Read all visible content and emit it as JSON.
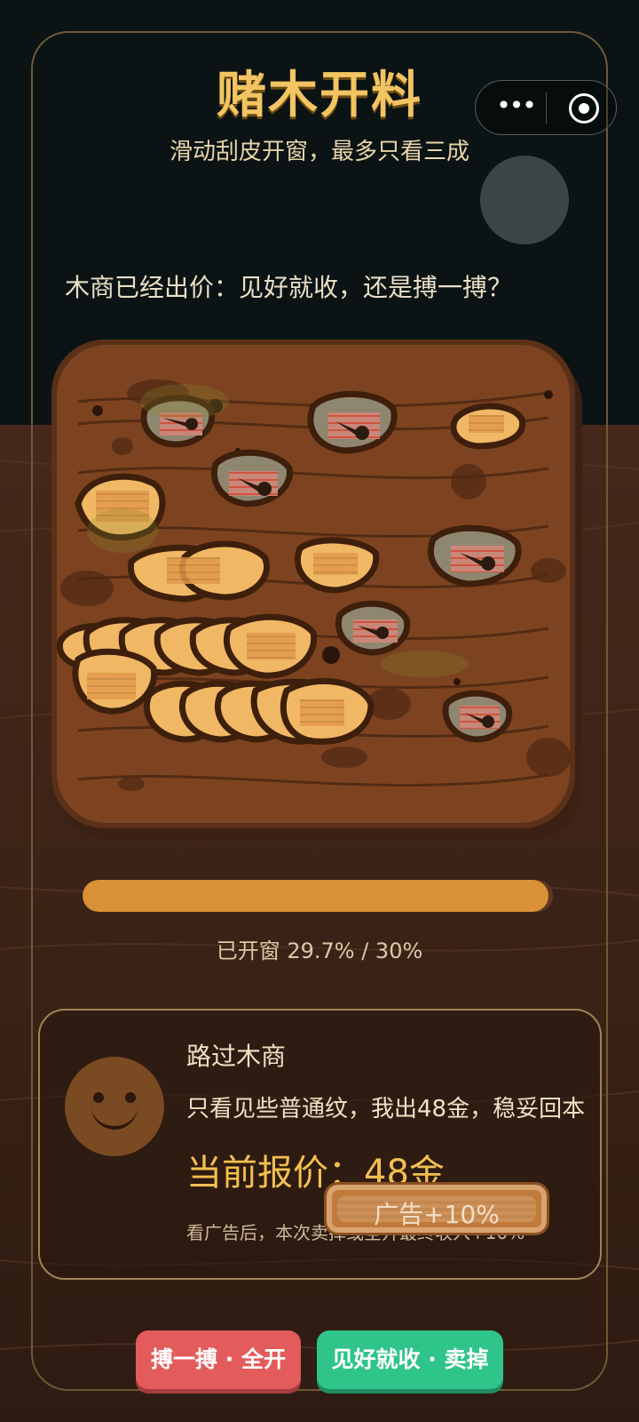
{
  "header": {
    "title": "赌木开料",
    "subtitle": "滑动刮皮开窗，最多只看三成"
  },
  "capsule": {
    "more_icon": "more-dots-icon",
    "close_icon": "target-circle-icon"
  },
  "prompt": "木商已经出价：见好就收，还是搏一搏？",
  "progress": {
    "label": "已开窗 29.7% / 30%",
    "value": 29.7,
    "max": 30
  },
  "merchant": {
    "name": "路过木商",
    "speech": "只看见些普通纹，我出48金，稳妥回本",
    "price_label": "当前报价：48金",
    "note": "看广告后，本次卖掉或全开最终收入+10%",
    "ad_button_label": "广告+10%",
    "avatar_icon": "smiley-face-icon"
  },
  "actions": {
    "gamble_label": "搏一搏 · 全开",
    "sell_label": "见好就收 · 卖掉"
  },
  "colors": {
    "title": "#f2c462",
    "price": "#f3c04f",
    "progress": "#d89137",
    "gamble": "#e35b5b",
    "sell": "#2fc48a"
  }
}
